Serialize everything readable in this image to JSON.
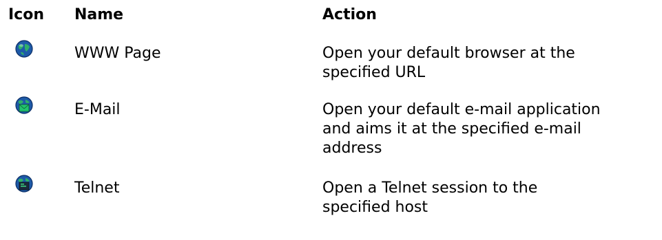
{
  "headers": {
    "icon": "Icon",
    "name": "Name",
    "action": "Action"
  },
  "rows": [
    {
      "icon": "globe-www-icon",
      "name": "WWW Page",
      "action_lines": [
        "Open your default browser at the",
        "specified URL"
      ]
    },
    {
      "icon": "globe-email-icon",
      "name": "E-Mail",
      "action_lines": [
        "Open your default e-mail application",
        "and aims it at the specified e-mail",
        "address"
      ]
    },
    {
      "icon": "globe-telnet-icon",
      "name": "Telnet",
      "action_lines": [
        "Open a Telnet session to the",
        "specified host"
      ]
    }
  ],
  "colors": {
    "globe_blue": "#1e5aa8",
    "globe_green": "#2fb06a",
    "envelope_green": "#22c36e",
    "terminal_dark": "#1a2a3a"
  }
}
